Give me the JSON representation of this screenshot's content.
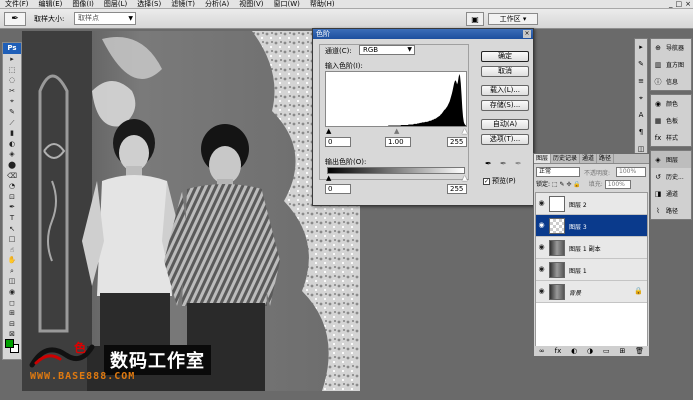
{
  "menu": [
    "文件(F)",
    "编辑(E)",
    "图像(I)",
    "图层(L)",
    "选择(S)",
    "滤镜(T)",
    "分析(A)",
    "视图(V)",
    "窗口(W)",
    "帮助(H)"
  ],
  "window_controls": [
    "_",
    "□",
    "×"
  ],
  "options": {
    "sample_size_label": "取样大小:",
    "sample_size_value": "取样点",
    "workspace_label": "工作区 ▾"
  },
  "toolbox": {
    "logo": "Ps",
    "tools": [
      "▸",
      "⬚",
      "◌",
      "✂",
      "⌖",
      "✎",
      "⟋",
      "▮",
      "◐",
      "◈",
      "⬤",
      "⌫",
      "◔",
      "⊡",
      "✒",
      "T",
      "↖",
      "□",
      "☝",
      "✋",
      "⌕",
      "◫",
      "◉",
      "◻",
      "⊞",
      "⊟",
      "⊠"
    ]
  },
  "canvas": {
    "logo_text": "数码工作室",
    "logo_mark": "色",
    "logo_url": "WWW.BASE888.COM"
  },
  "levels_dialog": {
    "title": "色阶",
    "channel_label": "通道(C):",
    "channel_value": "RGB",
    "input_label": "输入色阶(I):",
    "input_values": [
      "0",
      "1.00",
      "255"
    ],
    "output_label": "输出色阶(O):",
    "output_values": [
      "0",
      "255"
    ],
    "buttons": {
      "ok": "确定",
      "cancel": "取消",
      "load": "载入(L)...",
      "save": "存储(S)...",
      "auto": "自动(A)",
      "options": "选项(T)..."
    },
    "preview_label": "预览(P)",
    "preview_checked": true,
    "histogram": [
      0,
      0,
      0,
      0,
      0,
      0,
      0,
      0,
      0,
      0,
      0,
      0,
      0,
      0,
      0,
      0,
      0,
      0,
      0,
      0,
      0,
      0,
      0,
      0,
      0,
      0,
      0,
      0,
      0,
      0,
      0,
      0,
      0,
      0,
      0,
      0,
      0,
      0,
      0,
      0,
      0,
      0,
      0,
      0,
      0,
      0,
      0,
      0,
      0,
      0,
      0,
      0,
      0,
      0,
      0,
      0,
      0,
      0,
      0,
      0,
      0,
      0,
      0,
      0,
      0,
      0,
      0,
      0,
      0,
      0,
      0,
      0,
      0,
      0,
      0,
      0,
      0,
      0,
      0,
      0,
      0,
      0,
      0,
      0,
      1,
      1,
      1,
      1,
      1,
      1,
      1,
      1,
      1,
      1,
      1,
      1,
      1,
      1,
      1,
      1,
      1,
      2,
      2,
      2,
      2,
      2,
      2,
      2,
      2,
      2,
      2,
      3,
      3,
      3,
      3,
      3,
      3,
      3,
      4,
      4,
      4,
      4,
      4,
      5,
      5,
      5,
      6,
      6,
      6,
      7,
      7,
      7,
      7,
      8,
      8,
      8,
      8,
      9,
      9,
      10,
      10,
      10,
      11,
      12,
      12,
      13,
      14,
      14,
      15,
      16,
      17,
      18,
      19,
      20,
      22,
      23,
      25,
      27,
      29,
      31,
      32,
      34,
      36,
      38,
      41,
      44,
      47,
      52,
      57,
      62,
      68,
      75,
      82,
      86,
      88,
      85,
      80,
      84,
      93,
      100,
      96,
      82,
      60,
      35,
      18,
      8,
      4,
      2,
      1
    ]
  },
  "layers_panel": {
    "tabs": [
      "图层",
      "历史记录",
      "通道",
      "路径"
    ],
    "active_tab": "图层",
    "blend_mode": "正常",
    "opacity_label": "不透明度:",
    "opacity_value": "100%",
    "lock_label": "锁定:",
    "fill_label": "填充:",
    "fill_value": "100%",
    "layers": [
      {
        "name": "图层 2",
        "selected": false,
        "thumb": "white"
      },
      {
        "name": "图层 3",
        "selected": true,
        "thumb": "checker"
      },
      {
        "name": "图层 1 副本",
        "selected": false,
        "thumb": "photo"
      },
      {
        "name": "图层 1",
        "selected": false,
        "thumb": "photo"
      },
      {
        "name": "背景",
        "selected": false,
        "thumb": "photo",
        "locked": true
      }
    ],
    "bottom_icons": [
      "∞",
      "fx",
      "◐",
      "◑",
      "▭",
      "⊞",
      "🗑"
    ]
  },
  "dock": {
    "group1": [
      {
        "icon": "⊕",
        "label": "导航器"
      },
      {
        "icon": "▥",
        "label": "直方图"
      },
      {
        "icon": "ⓘ",
        "label": "信息"
      }
    ],
    "group2": [
      {
        "icon": "◉",
        "label": "颜色"
      },
      {
        "icon": "▦",
        "label": "色板"
      },
      {
        "icon": "fx",
        "label": "样式"
      }
    ],
    "group3": [
      {
        "icon": "◈",
        "label": "图层",
        "active": true
      },
      {
        "icon": "↺",
        "label": "历史..."
      },
      {
        "icon": "◨",
        "label": "通道"
      },
      {
        "icon": "⌇",
        "label": "路径"
      }
    ],
    "strip": [
      "▸",
      "✎",
      "≡",
      "⌖",
      "A",
      "¶",
      "◫",
      "▢"
    ]
  }
}
